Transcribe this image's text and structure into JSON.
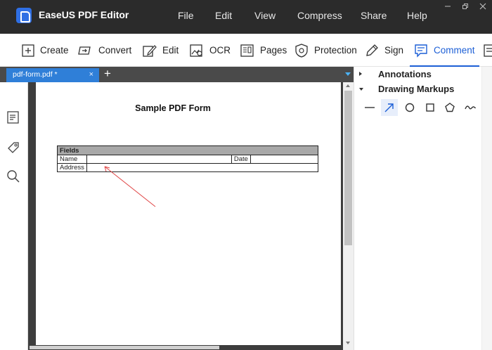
{
  "app": {
    "title": "EaseUS PDF Editor"
  },
  "menu": [
    "File",
    "Edit",
    "View",
    "Compress",
    "Share",
    "Help"
  ],
  "toolbar": {
    "create": "Create",
    "convert": "Convert",
    "edit": "Edit",
    "ocr": "OCR",
    "pages": "Pages",
    "protection": "Protection",
    "sign": "Sign",
    "comment": "Comment"
  },
  "tabs": [
    {
      "label": "pdf-form.pdf *",
      "close": "×"
    }
  ],
  "tab_add": "+",
  "document": {
    "title": "Sample PDF Form",
    "table": {
      "header": "Fields",
      "name_label": "Name",
      "date_label": "Date",
      "address_label": "Address"
    }
  },
  "right_panel": {
    "annotations": "Annotations",
    "drawing_markups": "Drawing Markups",
    "tools": [
      "line-tool",
      "arrow-tool",
      "circle-tool",
      "rectangle-tool",
      "polygon-tool",
      "cloud-tool"
    ]
  },
  "colors": {
    "accent": "#1c5fd6",
    "tab": "#2f7fd8",
    "titlebar": "#2b2b2b",
    "arrow": "#e04545"
  }
}
